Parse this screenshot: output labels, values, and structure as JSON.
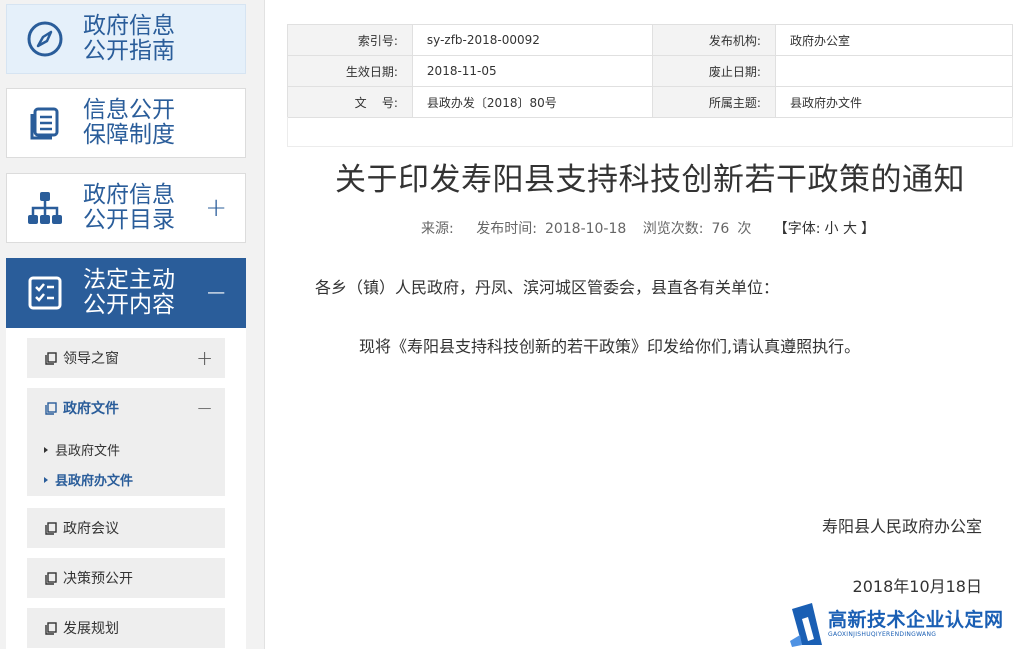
{
  "sidebar": {
    "big_items": [
      {
        "label": "政府信息公开指南",
        "icon": "compass-icon"
      },
      {
        "label": "信息公开保障制度",
        "icon": "document-stack-icon"
      },
      {
        "label": "政府信息公开目录",
        "icon": "org-chart-icon",
        "toggle": "+"
      },
      {
        "label": "法定主动公开内容",
        "icon": "checklist-icon",
        "toggle": "−"
      }
    ],
    "sub_items": [
      {
        "label": "领导之窗",
        "toggle": "+"
      },
      {
        "label": "政府文件",
        "toggle": "−"
      },
      {
        "label": "政府会议"
      },
      {
        "label": "决策预公开"
      },
      {
        "label": "发展规划"
      }
    ],
    "leaves": [
      {
        "label": "县政府文件"
      },
      {
        "label": "县政府办文件"
      }
    ]
  },
  "meta": {
    "index_label": "索引号:",
    "index_value": "sy-zfb-2018-00092",
    "publisher_label": "发布机构:",
    "publisher_value": "政府办公室",
    "effective_label": "生效日期:",
    "effective_value": "2018-11-05",
    "abolish_label": "废止日期:",
    "abolish_value": "",
    "docno_label": "文    号:",
    "docno_value": "县政办发〔2018〕80号",
    "topic_label": "所属主题:",
    "topic_value": "县政府办文件"
  },
  "article": {
    "title": "关于印发寿阳县支持科技创新若干政策的通知",
    "source_label": "来源:",
    "publish_label": "发布时间:",
    "publish_value": "2018-10-18",
    "views_label": "浏览次数:",
    "views_value": "76",
    "views_unit": "次",
    "font_label": "【字体:",
    "font_small": "小",
    "font_large": "大",
    "font_end": "】",
    "salutation": "各乡（镇）人民政府，丹凤、滨河城区管委会，县直各有关单位：",
    "body": "现将《寿阳县支持科技创新的若干政策》印发给你们,请认真遵照执行。",
    "signer": "寿阳县人民政府办公室",
    "sign_date": "2018年10月18日"
  },
  "watermark": {
    "title": "高新技术企业认定网",
    "subtitle": "GAOXINJISHUQIYERENDINGWANG"
  },
  "colors": {
    "brand_blue": "#2a5d9a",
    "guide_bg": "#e5f0fa",
    "watermark_blue": "#1a5fb4"
  }
}
